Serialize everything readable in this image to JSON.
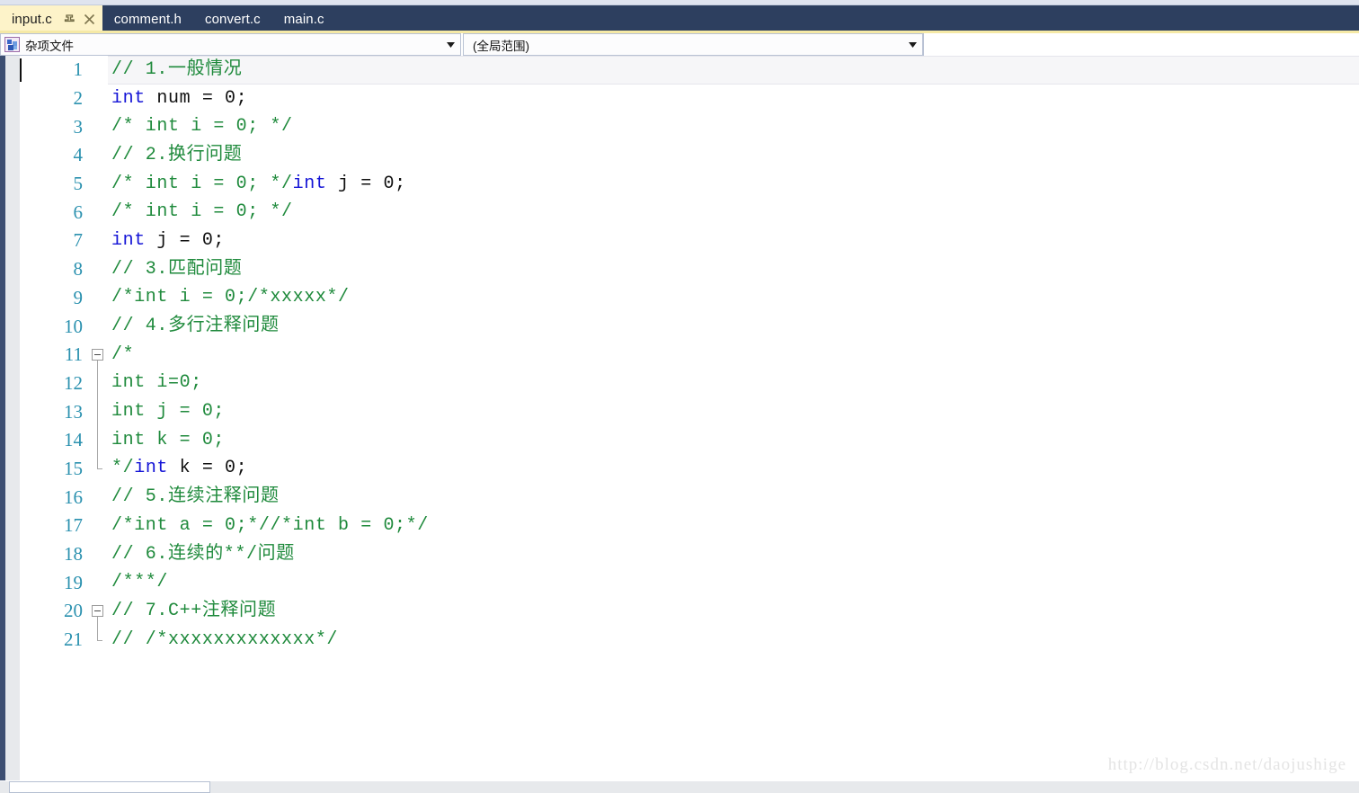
{
  "window": {
    "colors": {
      "tabbar_background": "#2d3f5f",
      "active_tab_background": "#fdf3c9",
      "accent_underline": "#f5e9a6",
      "comment_green": "#1f8a3c",
      "keyword_blue": "#1414d6",
      "linenumber_teal": "#2b91af",
      "margin_gray": "#e7e9ec",
      "edge_strip": "#3d4f72"
    }
  },
  "tabs": [
    {
      "label": "input.c",
      "active": true,
      "pin_icon": "pin-icon",
      "close_icon": "close-icon"
    },
    {
      "label": "comment.h",
      "active": false
    },
    {
      "label": "convert.c",
      "active": false
    },
    {
      "label": "main.c",
      "active": false
    }
  ],
  "navbar": {
    "project_combo": {
      "icon": "miscellaneous-files-icon",
      "value": "杂项文件",
      "arrow_icon": "chevron-down-icon"
    },
    "scope_combo": {
      "value": "(全局范围)",
      "arrow_icon": "chevron-down-icon"
    }
  },
  "editor": {
    "caret_line": 1,
    "lines": [
      {
        "n": "1",
        "fold": "none",
        "current": true,
        "tokens": [
          {
            "t": "// 1.一般情况",
            "c": "cmt"
          }
        ]
      },
      {
        "n": "2",
        "fold": "none",
        "tokens": [
          {
            "t": "int",
            "c": "kw"
          },
          {
            "t": " num = 0;",
            "c": "id"
          }
        ]
      },
      {
        "n": "3",
        "fold": "none",
        "tokens": [
          {
            "t": "/* int i = 0; */",
            "c": "cmt"
          }
        ]
      },
      {
        "n": "4",
        "fold": "none",
        "tokens": [
          {
            "t": "// 2.换行问题",
            "c": "cmt"
          }
        ]
      },
      {
        "n": "5",
        "fold": "none",
        "tokens": [
          {
            "t": "/* int i = 0; */",
            "c": "cmt"
          },
          {
            "t": "int",
            "c": "kw"
          },
          {
            "t": " j = 0;",
            "c": "id"
          }
        ]
      },
      {
        "n": "6",
        "fold": "none",
        "tokens": [
          {
            "t": "/* int i = 0; */",
            "c": "cmt"
          }
        ]
      },
      {
        "n": "7",
        "fold": "none",
        "tokens": [
          {
            "t": "int",
            "c": "kw"
          },
          {
            "t": " j = 0;",
            "c": "id"
          }
        ]
      },
      {
        "n": "8",
        "fold": "none",
        "tokens": [
          {
            "t": "// 3.匹配问题",
            "c": "cmt"
          }
        ]
      },
      {
        "n": "9",
        "fold": "none",
        "tokens": [
          {
            "t": "/*int i = 0;/*xxxxx*/",
            "c": "cmt"
          }
        ]
      },
      {
        "n": "10",
        "fold": "none",
        "tokens": [
          {
            "t": "// 4.多行注释问题",
            "c": "cmt"
          }
        ]
      },
      {
        "n": "11",
        "fold": "start",
        "tokens": [
          {
            "t": "/*",
            "c": "cmt"
          }
        ]
      },
      {
        "n": "12",
        "fold": "mid",
        "tokens": [
          {
            "t": "int i=0;",
            "c": "cmt"
          }
        ]
      },
      {
        "n": "13",
        "fold": "mid",
        "tokens": [
          {
            "t": "int j = 0;",
            "c": "cmt"
          }
        ]
      },
      {
        "n": "14",
        "fold": "mid",
        "tokens": [
          {
            "t": "int k = 0;",
            "c": "cmt"
          }
        ]
      },
      {
        "n": "15",
        "fold": "end",
        "tokens": [
          {
            "t": "*/",
            "c": "cmt"
          },
          {
            "t": "int",
            "c": "kw"
          },
          {
            "t": " k = 0;",
            "c": "id"
          }
        ]
      },
      {
        "n": "16",
        "fold": "none",
        "tokens": [
          {
            "t": "// 5.连续注释问题",
            "c": "cmt"
          }
        ]
      },
      {
        "n": "17",
        "fold": "none",
        "tokens": [
          {
            "t": "/*int a = 0;*//*int b = 0;*/",
            "c": "cmt"
          }
        ]
      },
      {
        "n": "18",
        "fold": "none",
        "tokens": [
          {
            "t": "// 6.连续的**/问题",
            "c": "cmt"
          }
        ]
      },
      {
        "n": "19",
        "fold": "none",
        "tokens": [
          {
            "t": "/***/",
            "c": "cmt"
          }
        ]
      },
      {
        "n": "20",
        "fold": "start",
        "tokens": [
          {
            "t": "// 7.C++注释问题",
            "c": "cmt"
          }
        ]
      },
      {
        "n": "21",
        "fold": "end",
        "tokens": [
          {
            "t": "// /*xxxxxxxxxxxxx*/",
            "c": "cmt"
          }
        ]
      }
    ]
  },
  "watermark": {
    "text": "http://blog.csdn.net/daojushige"
  }
}
